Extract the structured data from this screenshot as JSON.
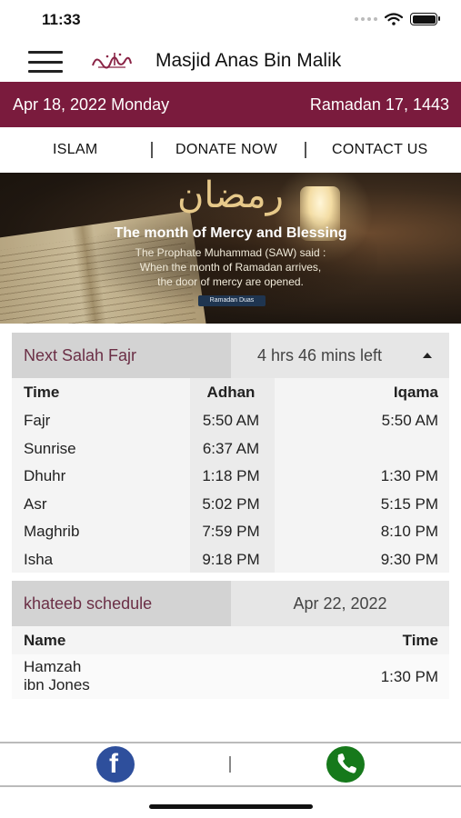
{
  "status": {
    "time": "11:33"
  },
  "header": {
    "title": "Masjid Anas Bin Malik"
  },
  "colors": {
    "brand": "#7a1b3d",
    "accent_text": "#6b2f46",
    "facebook": "#2e4f9c",
    "phone": "#16791b"
  },
  "date_bar": {
    "gregorian": "Apr 18, 2022 Monday",
    "hijri": "Ramadan 17, 1443"
  },
  "nav": {
    "items": [
      "ISLAM",
      "DONATE NOW",
      "CONTACT US"
    ]
  },
  "banner": {
    "arabic": "رمضان",
    "heading": "The month of Mercy and Blessing",
    "line1": "The Prophate Muhammad (SAW) said :",
    "line2": "When the month of Ramadan arrives,",
    "line3": "the door of mercy are opened.",
    "button": "Ramadan Duas"
  },
  "next_salah": {
    "label": "Next Salah Fajr",
    "remaining": "4 hrs  46 mins  left"
  },
  "salah_table": {
    "headers": [
      "Time",
      "Adhan",
      "Iqama"
    ],
    "rows": [
      {
        "name": "Fajr",
        "adhan": "5:50 AM",
        "iqama": "5:50 AM"
      },
      {
        "name": "Sunrise",
        "adhan": "6:37 AM",
        "iqama": ""
      },
      {
        "name": "Dhuhr",
        "adhan": "1:18 PM",
        "iqama": "1:30 PM"
      },
      {
        "name": "Asr",
        "adhan": "5:02 PM",
        "iqama": "5:15 PM"
      },
      {
        "name": "Maghrib",
        "adhan": "7:59 PM",
        "iqama": "8:10 PM"
      },
      {
        "name": "Isha",
        "adhan": "9:18 PM",
        "iqama": "9:30 PM"
      }
    ]
  },
  "khateeb": {
    "label": "khateeb schedule",
    "date": "Apr 22, 2022",
    "headers": [
      "Name",
      "Time"
    ],
    "entry_name_line1": "Hamzah",
    "entry_name_line2": "ibn Jones",
    "entry_time": "1:30 PM"
  },
  "bottom_bar": {
    "facebook_glyph": "f"
  }
}
